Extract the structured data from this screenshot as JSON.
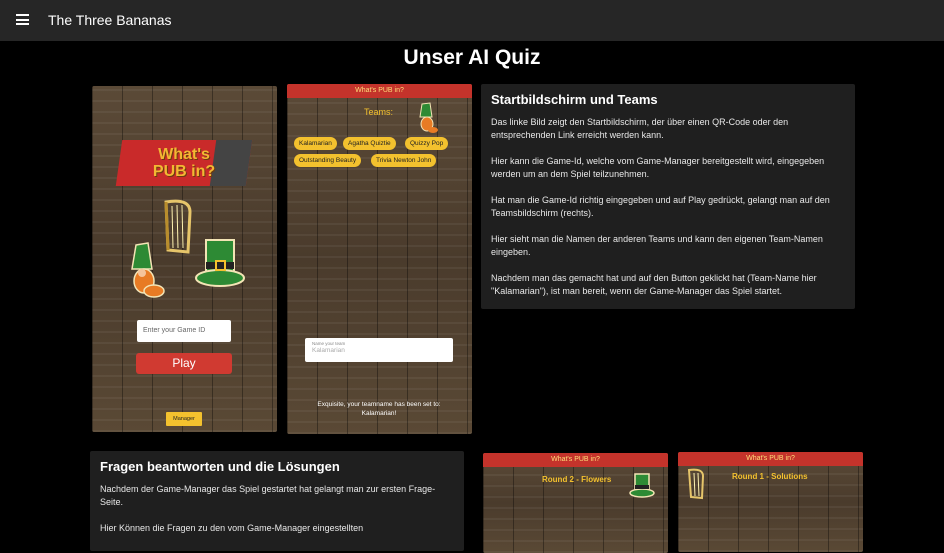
{
  "app": {
    "title": "The Three Bananas"
  },
  "page": {
    "title": "Unser AI Quiz"
  },
  "phones": {
    "start": {
      "logo_line1": "What's",
      "logo_line2": "PUB in?",
      "input_placeholder": "Enter your Game ID",
      "play_label": "Play",
      "manager_label": "Manager"
    },
    "teams": {
      "bar_title": "What's PUB in?",
      "teams_label": "Teams:",
      "chips": [
        "Kalamarian",
        "Agatha Quiztie",
        "Quizzy Pop",
        "Outstanding Beauty",
        "Trivia Newton John"
      ],
      "name_label": "Name your team",
      "name_value": "Kalamarian",
      "message_line1": "Exquisite, your teamname has been set to:",
      "message_line2": "Kalamarian!"
    },
    "round2": {
      "bar_title": "What's PUB in?",
      "round_title": "Round 2 - Flowers"
    },
    "round1": {
      "bar_title": "What's PUB in?",
      "round_title": "Round 1 - Solutions"
    }
  },
  "card1": {
    "title": "Startbildschirm und Teams",
    "paragraphs": [
      "Das linke Bild zeigt den Startbildschirm, der über einen QR-Code oder den entsprechenden Link erreicht werden kann.",
      "Hier kann die Game-Id, welche vom Game-Manager bereitgestellt wird, eingegeben werden um an dem Spiel teilzunehmen.",
      "Hat man die Game-Id richtig eingegeben und auf Play gedrückt, gelangt man auf den Teamsbildschirm (rechts).",
      "Hier sieht man die Namen der anderen Teams und kann den eigenen Team-Namen eingeben.",
      "Nachdem man das gemacht hat und auf den Button geklickt hat (Team-Name hier \"Kalamarian\"), ist man bereit, wenn der Game-Manager das Spiel startet."
    ]
  },
  "card2": {
    "title": "Fragen beantworten und die Lösungen",
    "paragraphs": [
      "Nachdem der Game-Manager das Spiel gestartet hat gelangt man zur ersten Frage-Seite.",
      "Hier Können die Fragen zu den vom Game-Manager eingestellten"
    ]
  },
  "colors": {
    "accent_red": "#c4332b",
    "accent_yellow": "#f3c12e",
    "card_bg": "#1f1f1f",
    "appbar_bg": "#262626"
  }
}
